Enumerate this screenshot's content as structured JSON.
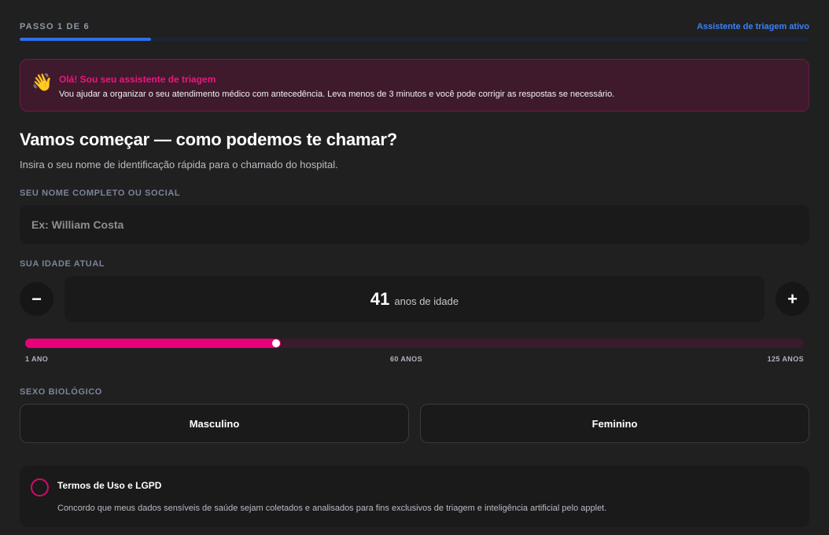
{
  "header": {
    "step_label": "PASSO 1 DE 6",
    "assistant_status": "Assistente de triagem ativo",
    "progress_fraction": 0.166,
    "accent_color": "#2f6fed"
  },
  "alert": {
    "icon": "waving-hand-icon",
    "emoji": "👋",
    "title": "Olá! Sou seu assistente de triagem",
    "text": "Vou ajudar a organizar o seu atendimento médico com antecedência. Leva menos de 3 minutos e você pode corrigir as respostas se necessário.",
    "title_color": "#f0147f"
  },
  "section": {
    "title": "Vamos começar — como podemos te chamar?",
    "subtitle": "Insira o seu nome de identificação rápida para o chamado do hospital."
  },
  "name_field": {
    "label": "SEU NOME COMPLETO OU SOCIAL",
    "value": "",
    "placeholder": "Ex: William Costa"
  },
  "age_field": {
    "label": "SUA IDADE ATUAL",
    "decrement_label": "−",
    "increment_label": "+",
    "value": "41",
    "unit": "anos de idade",
    "slider": {
      "min": 1,
      "max": 125,
      "value": 41,
      "min_label": "1 ANO",
      "mid_label": "60 ANOS",
      "max_label": "125 ANOS",
      "fill_color": "#e8007a"
    }
  },
  "sex_field": {
    "label": "SEXO BIOLÓGICO",
    "options": [
      "Masculino",
      "Feminino"
    ]
  },
  "terms": {
    "title": "Termos de Uso e LGPD",
    "text": "Concordo que meus dados sensíveis de saúde sejam coletados e analisados para fins exclusivos de triagem e inteligência artificial pelo applet.",
    "checked": false
  }
}
